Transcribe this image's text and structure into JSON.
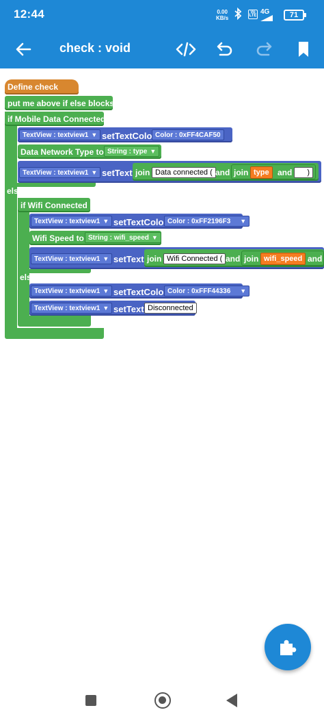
{
  "status": {
    "time": "12:44",
    "net_speed_value": "0.00",
    "net_speed_unit": "KB/s",
    "volte": "Vo LTE",
    "signal": "4G",
    "battery": "71",
    "icons": [
      "bluetooth-icon",
      "volte-icon",
      "signal-icon",
      "battery-icon"
    ]
  },
  "appbar": {
    "title": "check : void",
    "icons": [
      "back-arrow-icon",
      "code-icon",
      "undo-icon",
      "redo-icon",
      "bookmark-icon"
    ]
  },
  "blocks": {
    "define": "Define check",
    "comment": "put me above if else blocks",
    "if_mobile": "if Mobile Data Connected",
    "else1": "else",
    "if_wifi": "if Wifi Connected",
    "else2": "else",
    "textview_label": "TextView : textview1",
    "set_text_color": "setTextColor",
    "set_text": "setText",
    "color_1": "Color : 0xFF4CAF50",
    "color_2": "Color : 0xFF2196F3",
    "color_3": "Color : 0xFFF44336",
    "data_network_type_to": "Data Network Type to",
    "string_type": "String : type",
    "wifi_speed_to": "Wifi Speed to",
    "string_wifi_speed": "String : wifi_speed",
    "join": "join",
    "and": "and",
    "data_connected": "Data connected (",
    "type_var": "type",
    "close_paren": ")",
    "wifi_connected": "Wifi Connected (",
    "wifi_speed_var": "wifi_speed",
    "disconnected": "Disconnected"
  },
  "colors": {
    "primary": "#1e88d6",
    "define_block": "#d8872f",
    "control_block": "#4caf50",
    "view_block": "#4a64c4",
    "variable_block": "#f57c20"
  },
  "fab": {
    "icon": "puzzle-icon"
  },
  "navbar": {
    "icons": [
      "recents-square-icon",
      "home-circle-icon",
      "back-triangle-icon"
    ]
  }
}
